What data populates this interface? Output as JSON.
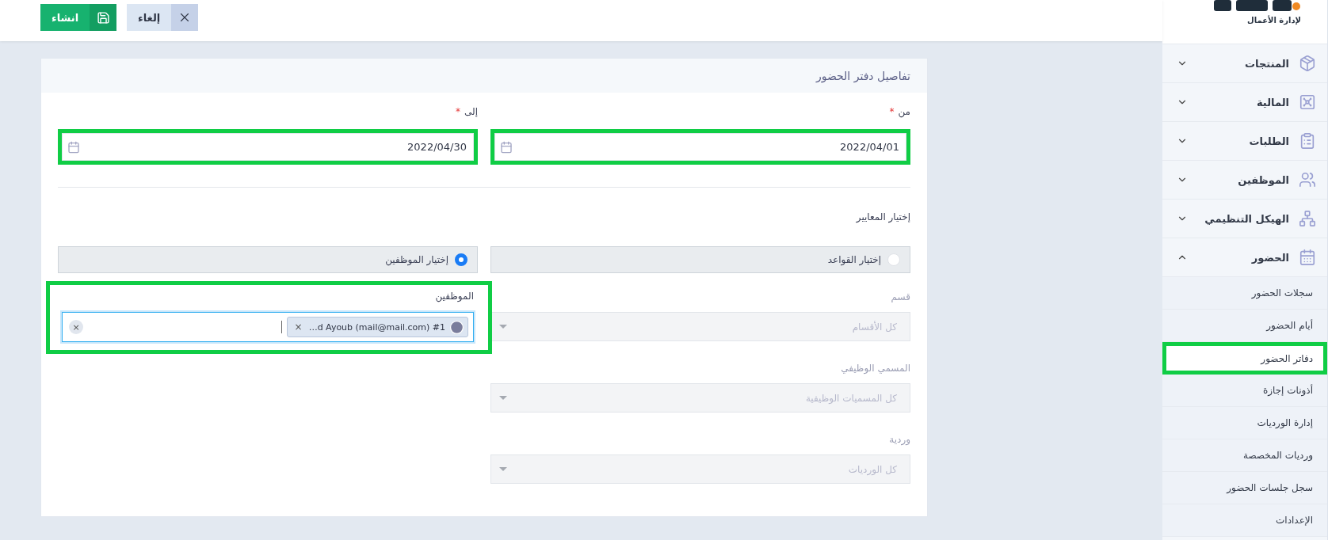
{
  "toolbar": {
    "buttons": [
      {
        "kind": "cancel",
        "label": "إلغاء"
      },
      {
        "kind": "create",
        "label": "انشاء"
      }
    ]
  },
  "sidebar": {
    "logo": {
      "tagline": "لإدارة الأعمال"
    },
    "items": [
      {
        "label": "المنتجات",
        "expanded": false
      },
      {
        "label": "المالية",
        "expanded": false
      },
      {
        "label": "الطلبات",
        "expanded": false
      },
      {
        "label": "الموظفين",
        "expanded": false
      },
      {
        "label": "الهيكل التنظيمي",
        "expanded": false
      },
      {
        "label": "الحضور",
        "expanded": true,
        "children": [
          {
            "label": "سجلات الحضور",
            "selected": false,
            "highlighted": false
          },
          {
            "label": "أيام الحضور",
            "selected": false,
            "highlighted": false
          },
          {
            "label": "دفاتر الحضور",
            "selected": true,
            "highlighted": true
          },
          {
            "label": "أذونات إجازة",
            "selected": false,
            "highlighted": false
          },
          {
            "label": "إدارة الورديات",
            "selected": false,
            "highlighted": false
          },
          {
            "label": "ورديات المخصصة",
            "selected": false,
            "highlighted": false
          },
          {
            "label": "سجل جلسات الحضور",
            "selected": false,
            "highlighted": false
          },
          {
            "label": "الإعدادات",
            "selected": false,
            "highlighted": false
          }
        ]
      }
    ]
  },
  "form": {
    "title": "تفاصيل دفتر الحضور",
    "dates": [
      {
        "label": "من",
        "required_mark": "*",
        "value": "2022/04/01",
        "highlighted": true
      },
      {
        "label": "إلى",
        "required_mark": "*",
        "value": "2022/04/30",
        "highlighted": true
      }
    ],
    "criteria": {
      "label": "إختيار المعايير",
      "options": [
        {
          "label": "إختيار القواعد",
          "selected": false
        },
        {
          "label": "إختيار الموظفين",
          "selected": true
        }
      ]
    },
    "employees": {
      "label": "الموظفين",
      "highlighted": true,
      "clear": "×",
      "tags": [
        {
          "text": "…d Ayoub (mail@mail.com) #1",
          "remove": "×"
        }
      ]
    },
    "filters": [
      {
        "label": "قسم",
        "placeholder": "كل الأقسام",
        "disabled": true
      },
      {
        "label": "المسمي الوظيفي",
        "placeholder": "كل المسميات الوظيفية",
        "disabled": true
      },
      {
        "label": "وردية",
        "placeholder": "كل الورديات",
        "disabled": true
      }
    ]
  }
}
